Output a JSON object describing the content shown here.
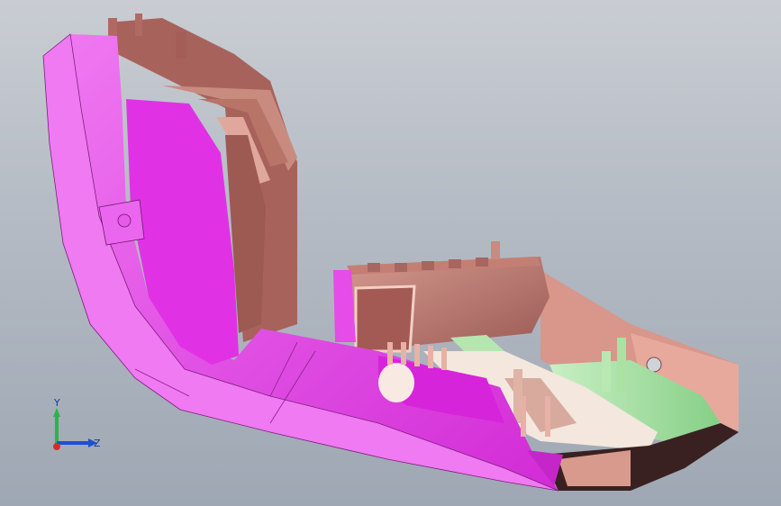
{
  "viewport": {
    "background_top": "#c9cdd3",
    "background_bottom": "#9ea7b3"
  },
  "model": {
    "colors": {
      "magenta_shell": "#e238e6",
      "magenta_light": "#f07af2",
      "copper": "#b8726a",
      "copper_light": "#d59a8f",
      "copper_dark": "#8c4e4a",
      "green": "#9ed99a",
      "cream": "#f2e6dc"
    }
  },
  "triad": {
    "y_label": "Y",
    "z_label": "Z",
    "y_color": "#2cb34a",
    "z_color": "#1f4fd1",
    "origin_color": "#d62b2b"
  }
}
